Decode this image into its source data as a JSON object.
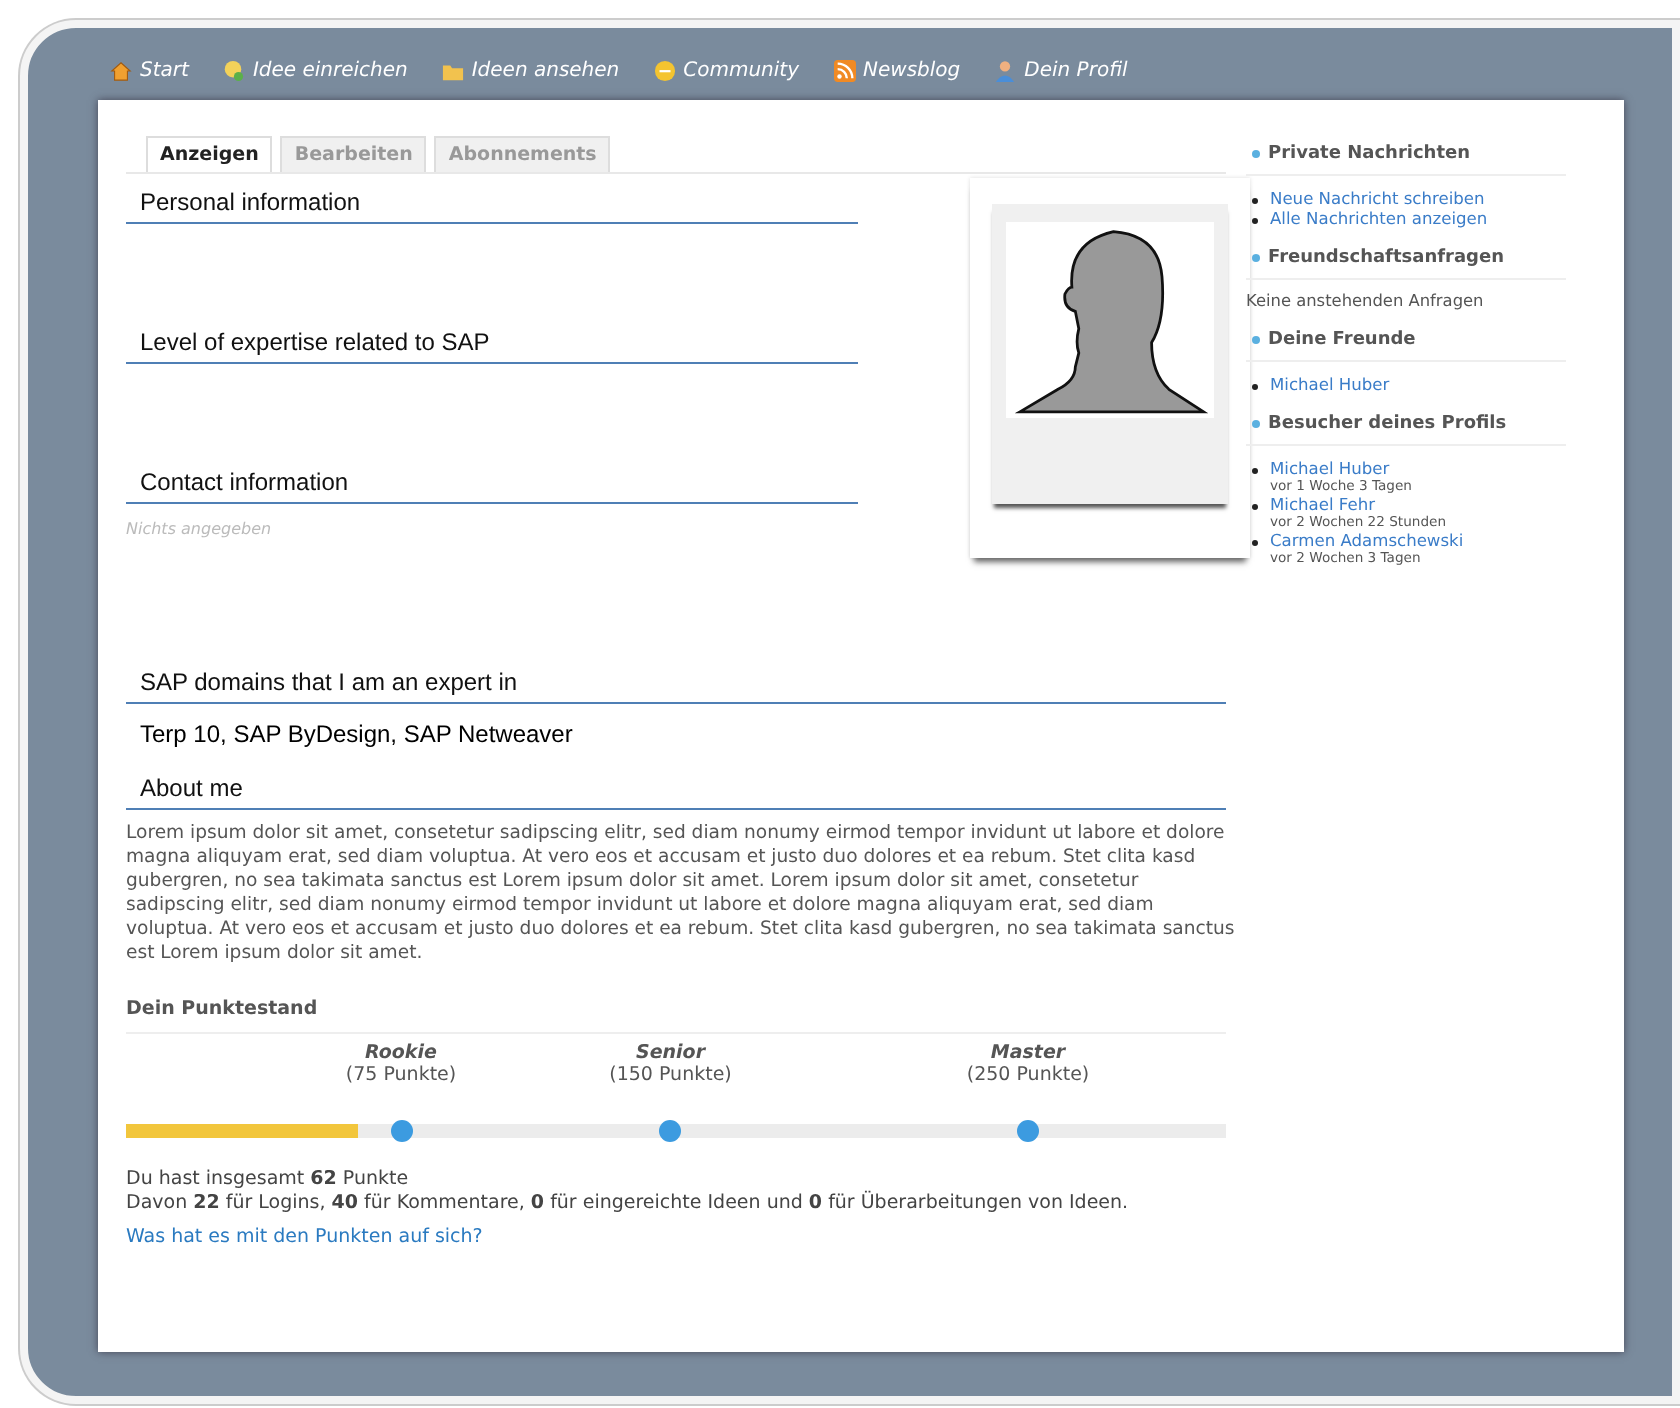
{
  "nav": [
    {
      "label": "Start"
    },
    {
      "label": "Idee einreichen"
    },
    {
      "label": "Ideen ansehen"
    },
    {
      "label": "Community"
    },
    {
      "label": "Newsblog"
    },
    {
      "label": "Dein Profil"
    }
  ],
  "tabs": [
    {
      "label": "Anzeigen",
      "selected": true
    },
    {
      "label": "Bearbeiten",
      "selected": false
    },
    {
      "label": "Abonnements",
      "selected": false
    }
  ],
  "top_sections": [
    {
      "heading": "Personal information"
    },
    {
      "heading": "Level of expertise related to SAP"
    },
    {
      "heading": "Contact information",
      "empty_note": "Nichts angegeben"
    }
  ],
  "domains": {
    "heading": "SAP domains that I am an expert in",
    "value": "Terp 10, SAP ByDesign, SAP Netweaver"
  },
  "about": {
    "heading": "About me",
    "text": "Lorem ipsum dolor sit amet, consetetur sadipscing elitr, sed diam nonumy eirmod tempor invidunt ut labore et dolore magna aliquyam erat, sed diam voluptua. At vero eos et accusam et justo duo dolores et ea rebum. Stet clita kasd gubergren, no sea takimata sanctus est Lorem ipsum dolor sit amet. Lorem ipsum dolor sit amet, consetetur sadipscing elitr, sed diam nonumy eirmod tempor invidunt ut labore et dolore magna aliquyam erat, sed diam voluptua. At vero eos et accusam et justo duo dolores et ea rebum. Stet clita kasd gubergren, no sea takimata sanctus est Lorem ipsum dolor sit amet."
  },
  "points": {
    "heading": "Dein Punktestand",
    "level": 0.21,
    "milestones": [
      {
        "name": "Rookie",
        "points": "(75 Punkte)"
      },
      {
        "name": "Senior",
        "points": "(150 Punkte)"
      },
      {
        "name": "Master",
        "points": "(250 Punkte)"
      }
    ],
    "summary": [
      "Du hast insgesamt **62** Punkte",
      "Davon **22** für Logins, **40** für Kommentare, **0** für eingereichte Ideen und **0** für Überarbeitungen von Ideen."
    ],
    "link": "Was hat es mit den Punkten auf sich?"
  },
  "sidebar": [
    {
      "title": "Private Nachrichten",
      "kind": "links",
      "items": [
        {
          "name": "Neue Nachricht schreiben"
        },
        {
          "name": "Alle Nachrichten anzeigen"
        }
      ]
    },
    {
      "title": "Freundschaftsanfragen",
      "kind": "text",
      "text": "Keine anstehenden Anfragen"
    },
    {
      "title": "Deine Freunde",
      "kind": "links",
      "items": [
        {
          "name": "Michael Huber"
        }
      ]
    },
    {
      "title": "Besucher deines Profils",
      "kind": "links",
      "items": [
        {
          "name": "Michael Huber",
          "time": "vor 1 Woche 3 Tagen"
        },
        {
          "name": "Michael Fehr",
          "time": "vor 2 Wochen 22 Stunden"
        },
        {
          "name": "Carmen Adamschewski",
          "time": "vor 2 Wochen 3 Tagen"
        }
      ]
    }
  ]
}
